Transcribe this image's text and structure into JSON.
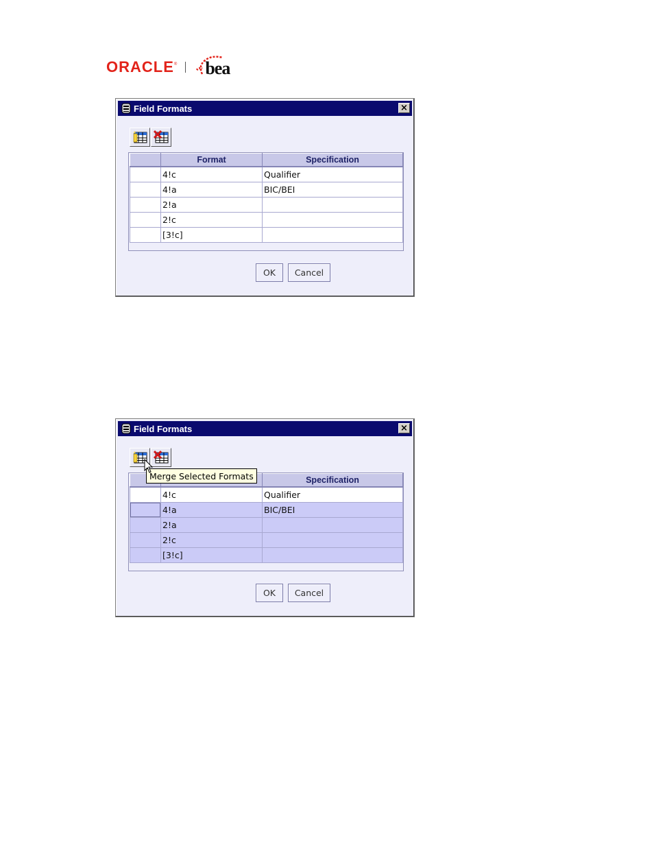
{
  "header": {
    "oracle_logo_text": "ORACLE",
    "oracle_tm": "®",
    "bea_logo_text": "bea"
  },
  "colors": {
    "oracle_red": "#e2231a",
    "titlebar_blue": "#0a0a6e",
    "dialog_bg": "#eeeefa",
    "selected_row": "#cbcbf7",
    "header_bg": "#c8c8e8"
  },
  "icons": {
    "titlebar": "window-app-icon",
    "close": "close-icon",
    "merge": "merge-formats-icon",
    "delete": "delete-formats-icon"
  },
  "dialogs": [
    {
      "title": "Field Formats",
      "close_glyph": "×",
      "columns": [
        "",
        "Format",
        "Specification"
      ],
      "rows": [
        {
          "format": "4!c",
          "spec": "Qualifier",
          "selected": false
        },
        {
          "format": "4!a",
          "spec": "BIC/BEI",
          "selected": false
        },
        {
          "format": "2!a",
          "spec": "",
          "selected": false
        },
        {
          "format": "2!c",
          "spec": "",
          "selected": false
        },
        {
          "format": "[3!c]",
          "spec": "",
          "selected": false
        }
      ],
      "ok_label": "OK",
      "cancel_label": "Cancel"
    },
    {
      "title": "Field Formats",
      "close_glyph": "×",
      "columns": [
        "",
        "Format",
        "Specification"
      ],
      "rows": [
        {
          "format": "4!c",
          "spec": "Qualifier",
          "selected": false
        },
        {
          "format": "4!a",
          "spec": "BIC/BEI",
          "selected": true
        },
        {
          "format": "2!a",
          "spec": "",
          "selected": true
        },
        {
          "format": "2!c",
          "spec": "",
          "selected": true
        },
        {
          "format": "[3!c]",
          "spec": "",
          "selected": true
        }
      ],
      "tooltip": "Merge Selected Formats",
      "ok_label": "OK",
      "cancel_label": "Cancel"
    }
  ]
}
